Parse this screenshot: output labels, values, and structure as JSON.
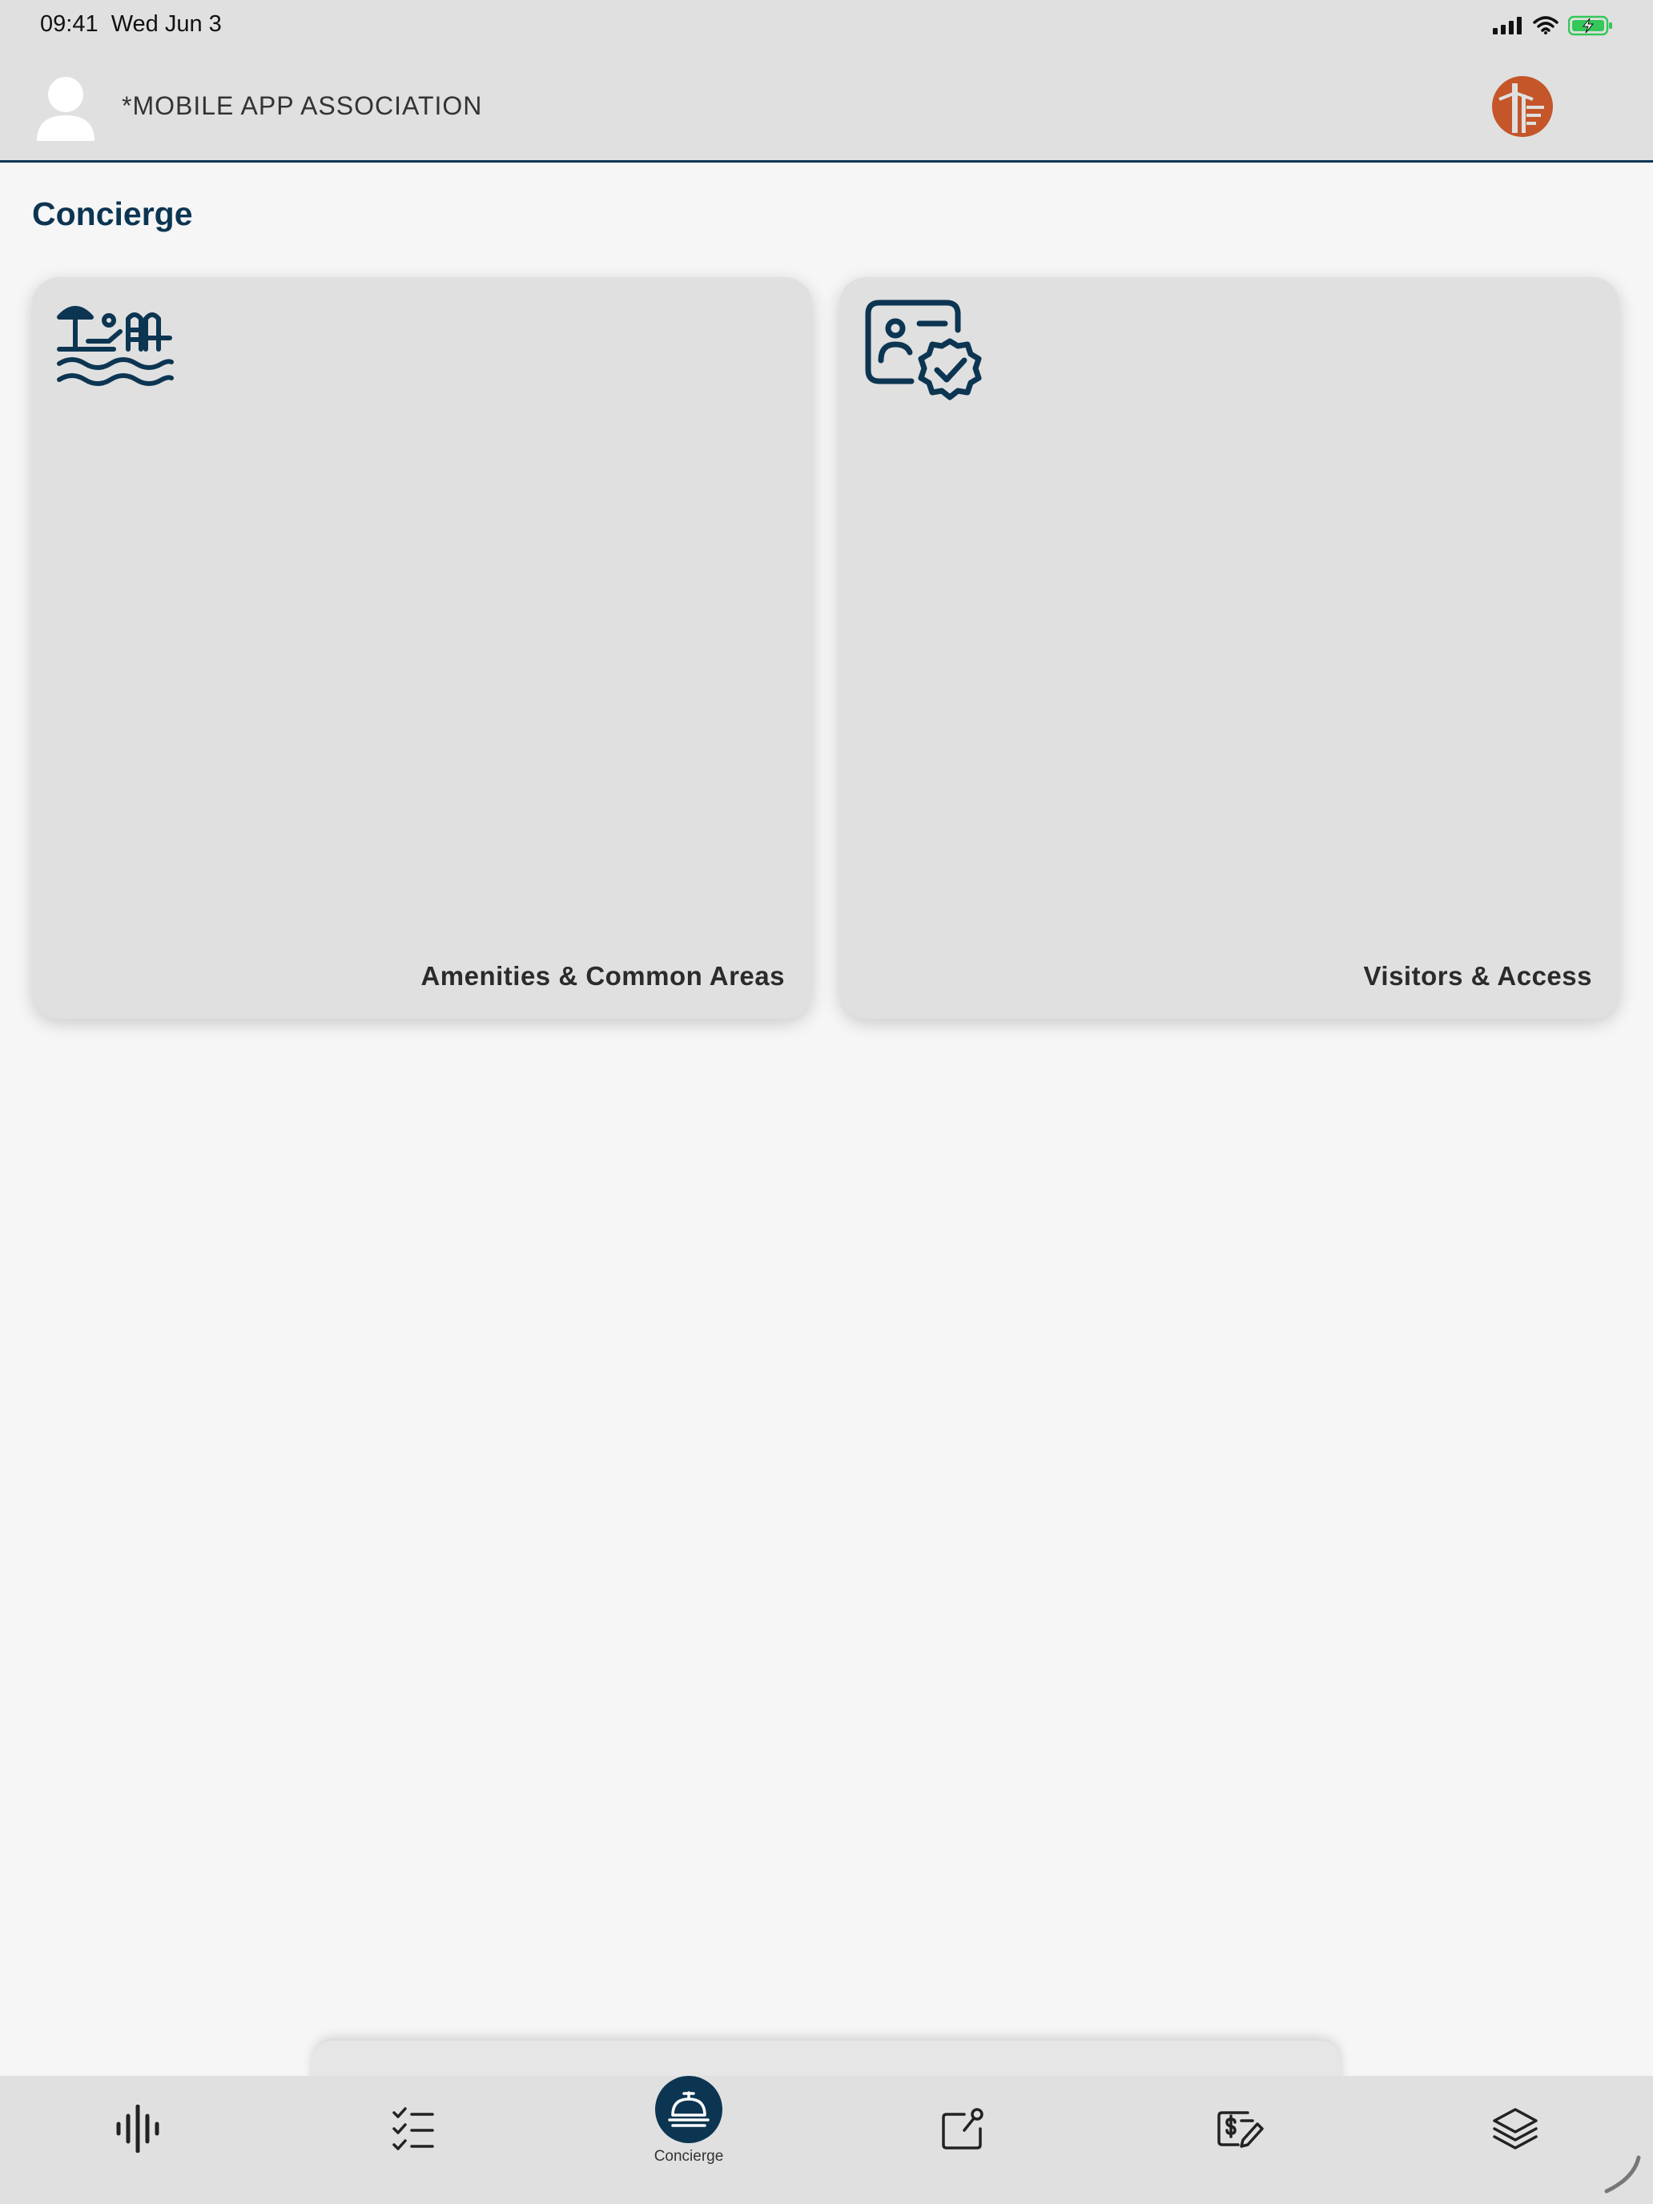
{
  "status_bar": {
    "time": "09:41",
    "date": "Wed Jun 3",
    "icons": [
      "cellular-signal-icon",
      "wifi-icon",
      "battery-charging-icon"
    ]
  },
  "header": {
    "org_name": "*MOBILE APP ASSOCIATION",
    "avatar_icon": "user-avatar-icon",
    "logo_icon": "brand-logo-icon"
  },
  "page": {
    "title": "Concierge"
  },
  "cards": [
    {
      "label": "Amenities & Common Areas",
      "icon": "pool-umbrella-icon"
    },
    {
      "label": "Visitors & Access",
      "icon": "id-card-check-icon"
    }
  ],
  "tab_bar": {
    "tabs": [
      {
        "icon": "activity-waveform-icon",
        "label": ""
      },
      {
        "icon": "checklist-icon",
        "label": ""
      },
      {
        "icon": "concierge-bell-icon",
        "label": "Concierge",
        "active": true
      },
      {
        "icon": "edit-square-icon",
        "label": ""
      },
      {
        "icon": "payment-edit-icon",
        "label": ""
      },
      {
        "icon": "layers-icon",
        "label": ""
      }
    ]
  },
  "colors": {
    "primary": "#0c3552",
    "brand_accent": "#c4562a",
    "surface": "#e0e0e0",
    "background": "#f6f6f6"
  }
}
